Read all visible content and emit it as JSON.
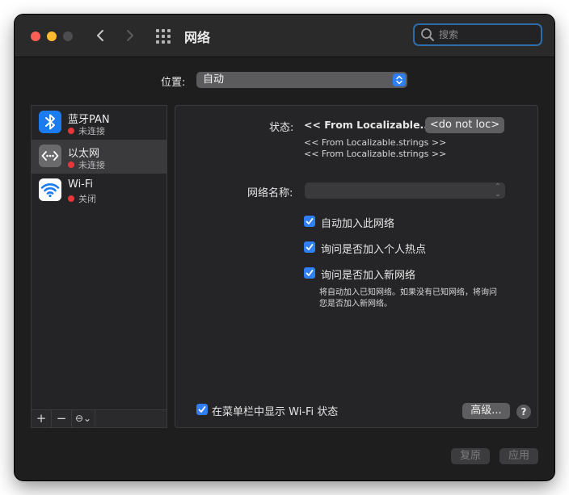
{
  "window": {
    "title": "网络"
  },
  "search": {
    "placeholder": "搜索"
  },
  "location": {
    "label": "位置:",
    "value": "自动"
  },
  "services": [
    {
      "name": "蓝牙PAN",
      "status": "未连接",
      "icon": "bluetooth-icon"
    },
    {
      "name": "以太网",
      "status": "未连接",
      "icon": "ethernet-icon"
    },
    {
      "name": "Wi-Fi",
      "status": "关闭",
      "icon": "wifi-icon"
    }
  ],
  "sidebar_bar": {
    "add": "+",
    "remove": "−",
    "action": "⊖⌄"
  },
  "detail": {
    "status_label": "状态:",
    "status_value": "<< From Localizable...",
    "status_button": "<do not loc>",
    "status_line1": "<< From Localizable.strings >>",
    "status_line2": "<< From Localizable.strings >>",
    "network_name_label": "网络名称:",
    "checkboxes": [
      {
        "label": "自动加入此网络",
        "checked": true
      },
      {
        "label": "询问是否加入个人热点",
        "checked": true
      },
      {
        "label": "询问是否加入新网络",
        "checked": true
      }
    ],
    "hint_line1": "将自动加入已知网络。如果没有已知网络，将询问",
    "hint_line2": "您是否加入新网络。",
    "show_wifi_label": "在菜单栏中显示 Wi-Fi 状态",
    "show_wifi_checked": true,
    "advanced_button": "高级...",
    "help": "?"
  },
  "footer": {
    "revert": "复原",
    "apply": "应用"
  },
  "colors": {
    "accent": "#2f7ef6",
    "status_red": "#e8363a"
  }
}
